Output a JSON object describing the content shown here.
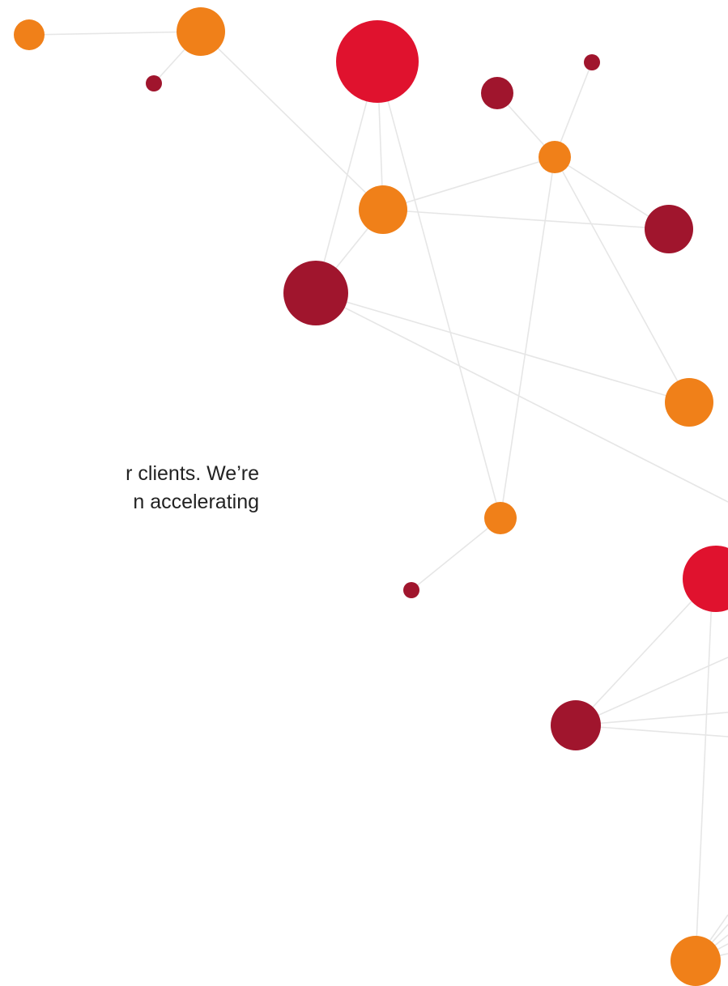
{
  "intro_text": {
    "line_1": "r clients. We’re",
    "line_2": "n accelerating"
  },
  "colors": {
    "edge": "#e6e6e6",
    "orange": "#f08019",
    "red": "#e0122e",
    "maroon": "#a0152d",
    "text": "#222222"
  }
}
